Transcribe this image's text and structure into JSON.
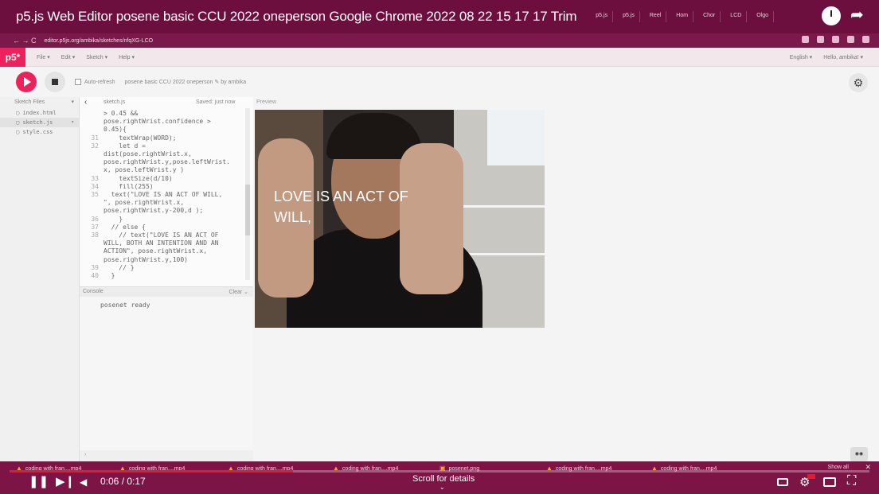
{
  "video_title": "p5.js Web Editor posene basic CCU 2022 oneperson Google Chrome 2022 08 22 15 17 17 Trim",
  "browser": {
    "url": "editor.p5js.org/ambika/sketches/nfqXG-LCO",
    "tab_labels": [
      "p5.js",
      "p5.js",
      "Reel",
      "Hom",
      "Chor",
      "LCD",
      "Olgo"
    ]
  },
  "p5": {
    "logo": "p5*",
    "menu": [
      "File ▾",
      "Edit ▾",
      "Sketch ▾",
      "Help ▾"
    ],
    "language": "English ▾",
    "user": "Hello, ambika! ▾",
    "auto_refresh": "Auto-refresh",
    "sketch_title": "posene basic CCU 2022 oneperson ✎  by ambika",
    "sidebar_title": "Sketch Files",
    "files": [
      "index.html",
      "sketch.js",
      "style.css"
    ],
    "code_file": "sketch.js",
    "saved": "Saved: just now",
    "preview_label": "Preview",
    "console_title": "Console",
    "console_clear": "Clear ⌄",
    "console_output": "posenet ready",
    "overlay_text_line1": "LOVE IS AN ACT OF",
    "overlay_text_line2": "WILL,"
  },
  "code": [
    {
      "ln": "",
      "t": "> 0.45 &&"
    },
    {
      "ln": "",
      "t": "pose.rightWrist.confidence >"
    },
    {
      "ln": "",
      "t": "0.45){"
    },
    {
      "ln": "31",
      "t": "    textWrap(WORD);"
    },
    {
      "ln": "32",
      "t": "    let d ="
    },
    {
      "ln": "",
      "t": "dist(pose.rightWrist.x,"
    },
    {
      "ln": "",
      "t": "pose.rightWrist.y,pose.leftWrist."
    },
    {
      "ln": "",
      "t": "x, pose.leftWrist.y )"
    },
    {
      "ln": "33",
      "t": "    textSize(d/10)"
    },
    {
      "ln": "34",
      "t": "    fill(255)"
    },
    {
      "ln": "35",
      "t": "  text(\"LOVE IS AN ACT OF WILL,"
    },
    {
      "ln": "",
      "t": "\", pose.rightWrist.x,"
    },
    {
      "ln": "",
      "t": "pose.rightWrist.y-200,d );"
    },
    {
      "ln": "36",
      "t": "    }"
    },
    {
      "ln": "37",
      "t": "  // else {"
    },
    {
      "ln": "38",
      "t": "    // text(\"LOVE IS AN ACT OF"
    },
    {
      "ln": "",
      "t": "WILL, BOTH AN INTENTION AND AN"
    },
    {
      "ln": "",
      "t": "ACTION\", pose.rightWrist.x,"
    },
    {
      "ln": "",
      "t": "pose.rightWrist.y,100)"
    },
    {
      "ln": "39",
      "t": "    // }"
    },
    {
      "ln": "40",
      "t": "  }"
    }
  ],
  "downloads": [
    "coding with fran....mp4",
    "coding with fran....mp4",
    "coding with fran....mp4",
    "coding with fran....mp4",
    "posenet.png",
    "coding with fran....mp4",
    "coding with fran....mp4"
  ],
  "downloads_show_all": "Show all",
  "player": {
    "time": "0:06 / 0:17",
    "scroll_hint": "Scroll for details",
    "progress": 0.33
  },
  "colors": {
    "accent": "#ed225d",
    "frame": "#7c1545",
    "progress": "#e01c2e"
  }
}
